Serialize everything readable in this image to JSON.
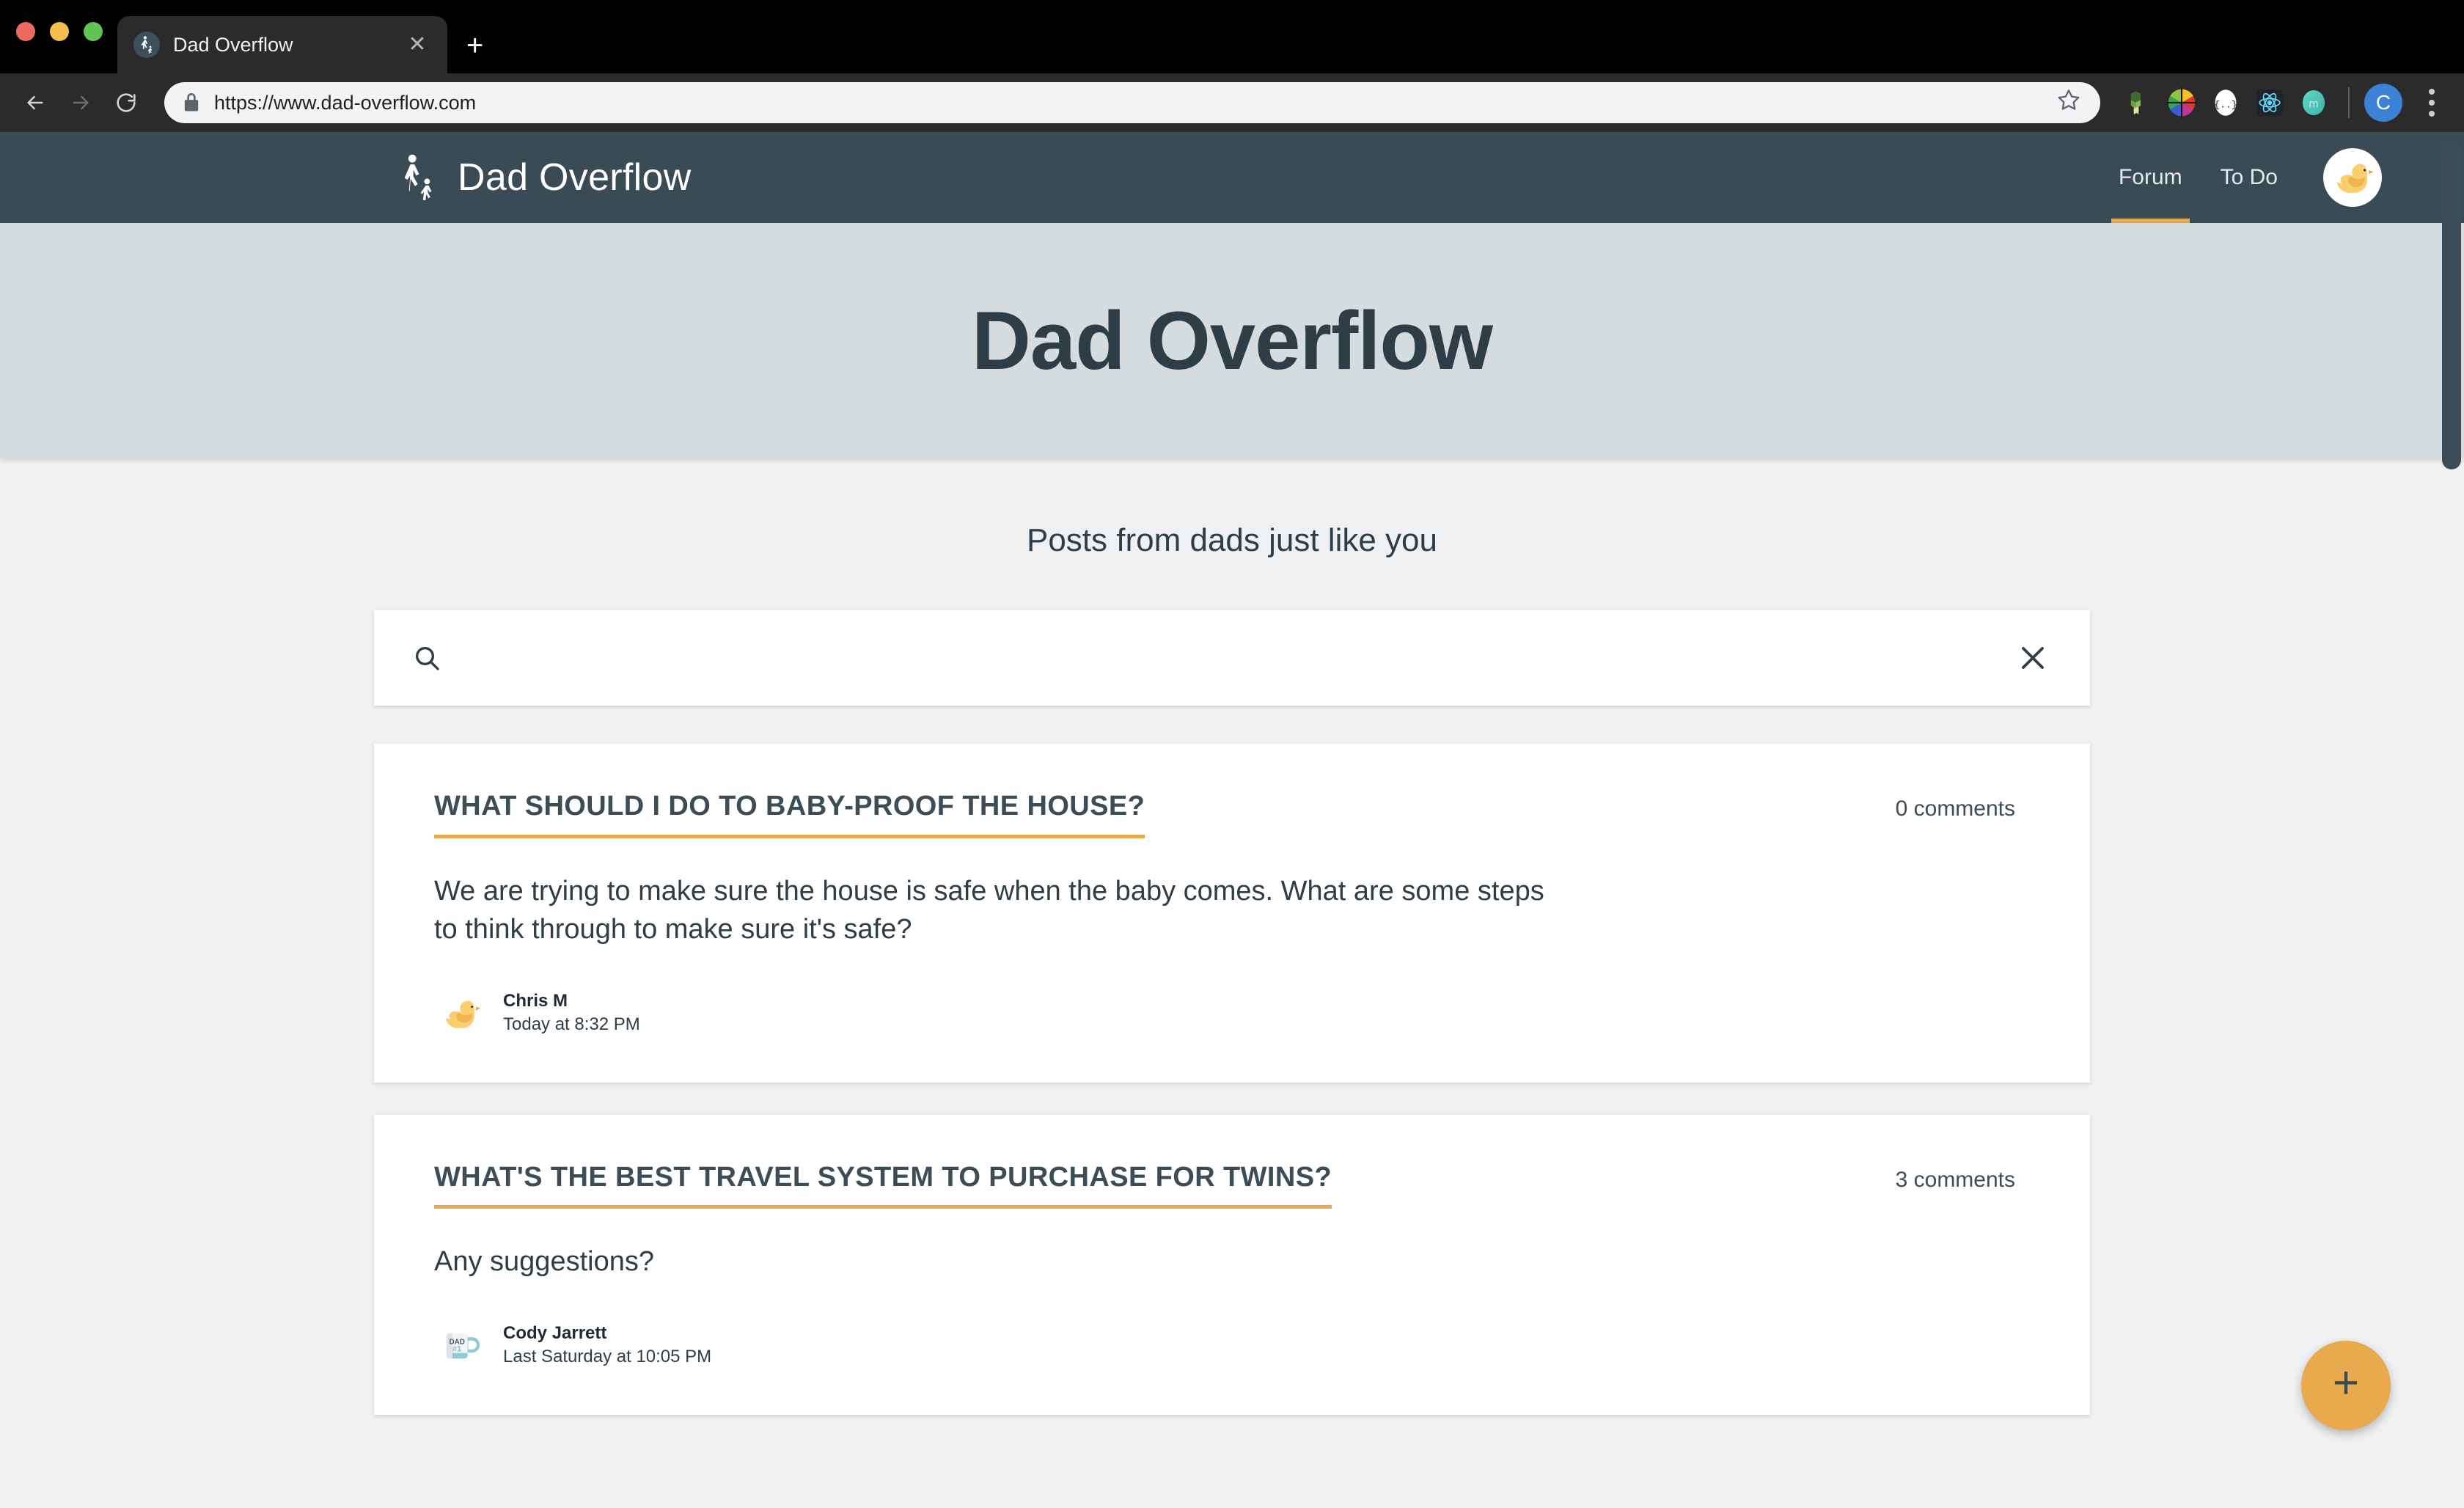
{
  "browser": {
    "tab": {
      "title": "Dad Overflow",
      "favicon_icon": "dad-and-child-walking-icon",
      "close_icon": "close-icon"
    },
    "new_tab_label": "+",
    "back_icon": "back-arrow-icon",
    "forward_icon": "forward-arrow-icon",
    "reload_icon": "reload-icon",
    "lock_icon": "lock-icon",
    "url": "https://www.dad-overflow.com",
    "bookmark_icon": "star-icon",
    "extensions": [
      {
        "name": "blocks-extension-icon",
        "color": "#7CA24B"
      },
      {
        "name": "color-wheel-extension-icon",
        "color": "#E23B3B"
      },
      {
        "name": "json-viewer-extension-icon",
        "color": "#FFFFFF"
      },
      {
        "name": "react-devtools-extension-icon",
        "color": "#61DAFB"
      },
      {
        "name": "momentum-extension-icon",
        "color": "#4ECDC4"
      }
    ],
    "profile_initial": "C",
    "menu_icon": "kebab-menu-icon"
  },
  "site": {
    "brand": {
      "logo_icon": "dad-and-child-walking-icon",
      "name": "Dad Overflow"
    },
    "nav": [
      {
        "label": "Forum",
        "active": true
      },
      {
        "label": "To Do",
        "active": false
      }
    ],
    "user_avatar_icon": "rubber-duck-avatar-icon",
    "hero_title": "Dad Overflow",
    "subtitle": "Posts from dads just like you"
  },
  "search": {
    "value": "",
    "placeholder": "",
    "search_icon": "search-icon",
    "clear_icon": "clear-x-icon"
  },
  "posts": [
    {
      "title": "What should I do to baby-proof the house?",
      "comments": "0 comments",
      "body": "We are trying to make sure the house is safe when the baby comes. What are some steps to think through to make sure it's safe?",
      "author": "Chris M",
      "timestamp": "Today at 8:32 PM",
      "avatar_icon": "rubber-duck-avatar-icon"
    },
    {
      "title": "What's the best travel system to purchase for twins?",
      "comments": "3 comments",
      "body": "Any suggestions?",
      "author": "Cody Jarrett",
      "timestamp": "Last Saturday at 10:05 PM",
      "avatar_icon": "dad-number-one-mug-avatar-icon"
    }
  ],
  "fab": {
    "label": "+",
    "icon": "plus-icon"
  },
  "colors": {
    "header_bg": "#394B54",
    "hero_bg": "#D4DCE0",
    "page_bg": "#EEF0F2",
    "accent": "#E9A94D",
    "text_dark": "#2F3E46"
  }
}
